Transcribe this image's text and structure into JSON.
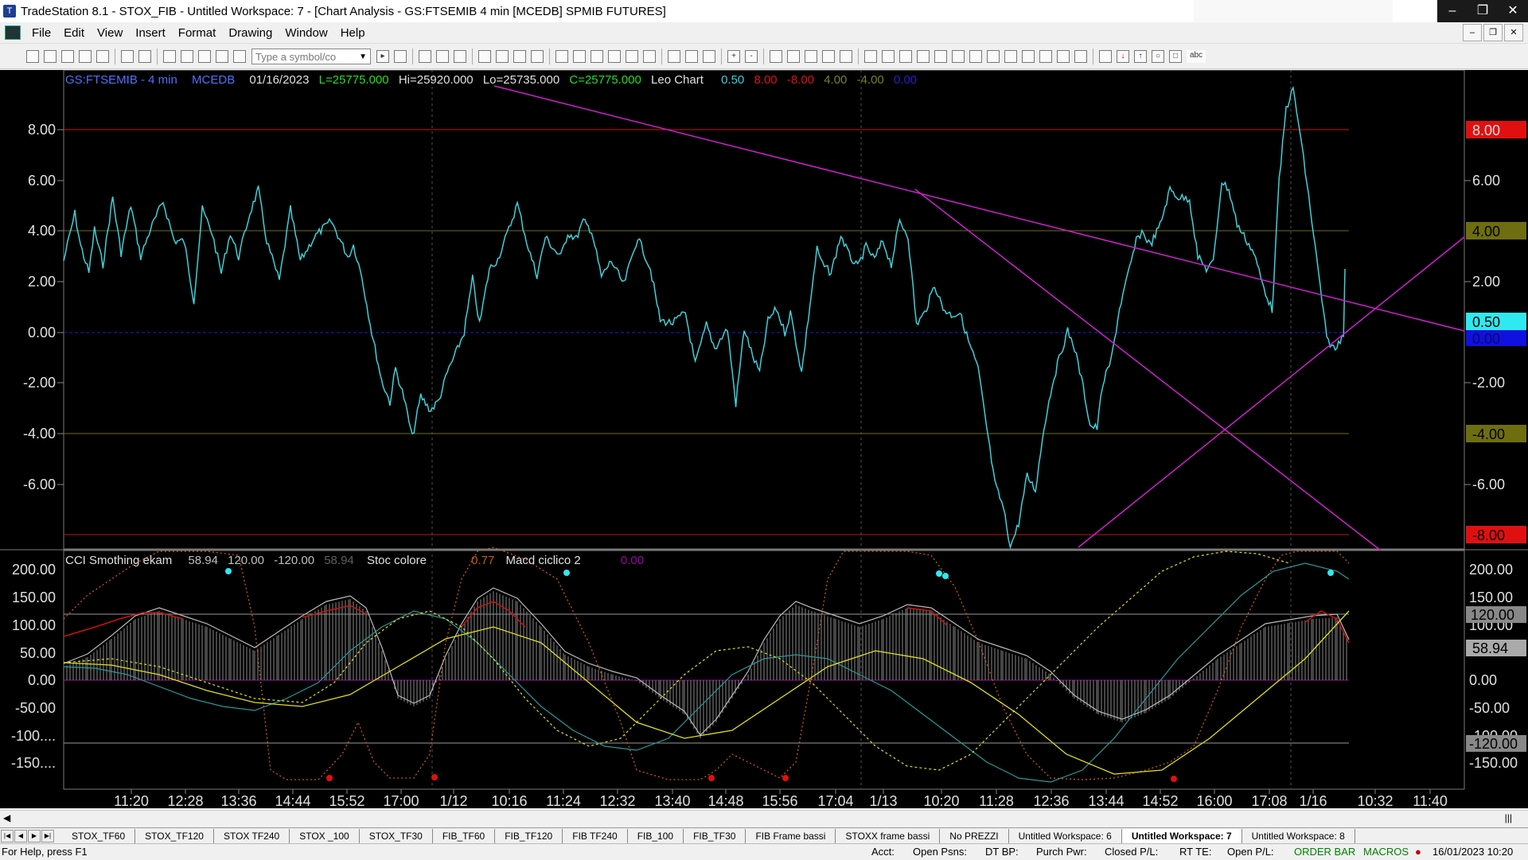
{
  "window": {
    "title": "TradeStation 8.1 - STOX_FIB - Untitled Workspace:  7 - [Chart Analysis - GS:FTSEMIB  4 min  [MCEDB] SPMIB FUTURES]"
  },
  "menu": [
    "File",
    "Edit",
    "View",
    "Insert",
    "Format",
    "Drawing",
    "Window",
    "Help"
  ],
  "toolbar": {
    "symbol_placeholder": "Type a symbol/co"
  },
  "chart_header": {
    "symbol": "GS:FTSEMIB - 4 min",
    "feed": "MCEDB",
    "date": "01/16/2023",
    "last": "L=25775.000",
    "high": "Hi=25920.000",
    "low": "Lo=25735.000",
    "close": "C=25775.000",
    "study": "Leo Chart",
    "v1": "0.50",
    "v2": "8.00",
    "v3": "-8.00",
    "v4": "4.00",
    "v5": "-4.00",
    "v6": "0.00"
  },
  "lower_header": {
    "study1": "CCI Smothing ekam",
    "a": "58.94",
    "b": "120.00",
    "c": "-120.00",
    "d": "58.94",
    "study2": "Stoc colore",
    "e": "0.77",
    "study3": "Macd ciclico 2",
    "f": "0.00"
  },
  "upper_axis": [
    "8.00",
    "6.00",
    "4.00",
    "2.00",
    "0.00",
    "-2.00",
    "-4.00",
    "-6.00"
  ],
  "upper_right_axis": [
    "8.00",
    "6.00",
    "4.00",
    "2.00",
    "0.50",
    "0.00",
    "-2.00",
    "-4.00",
    "-6.00",
    "-8.00"
  ],
  "lower_axis": [
    "200.00",
    "150.00",
    "100.00",
    "50.00",
    "0.00",
    "-50.00",
    "-100....",
    "-150...."
  ],
  "lower_right_axis": [
    "200.00",
    "150.00",
    "120.00",
    "100.00",
    "58.94",
    "0.00",
    "-50.00",
    "-100.00",
    "-120.00",
    "-150.00"
  ],
  "time_axis": [
    "11:20",
    "12:28",
    "13:36",
    "14:44",
    "15:52",
    "17:00",
    "1/12",
    "10:16",
    "11:24",
    "12:32",
    "13:40",
    "14:48",
    "15:56",
    "17:04",
    "1/13",
    "10:20",
    "11:28",
    "12:36",
    "13:44",
    "14:52",
    "16:00",
    "17:08",
    "1/16",
    "10:32",
    "11:40"
  ],
  "colors": {
    "price": "#3fd0d8",
    "trend": "#d020d0",
    "red_line": "#d01010",
    "olive_line": "#6e6e10",
    "zero_line": "#2020d0"
  },
  "workspace_tabs": [
    "STOX_TF60",
    "STOX_TF120",
    "STOX TF240",
    "STOX _100",
    "STOX_TF30",
    "FIB_TF60",
    "FIB_TF120",
    "FIB TF240",
    "FIB_100",
    "FIB_TF30",
    "FIB Frame bassi",
    "STOXX frame bassi",
    "No PREZZI",
    "Untitled Workspace:  6",
    "Untitled Workspace:  7",
    "Untitled Workspace:  8"
  ],
  "status": {
    "help": "For Help, press F1",
    "acct": "Acct:",
    "open_psns": "Open Psns:",
    "dt_bp": "DT BP:",
    "purch_pwr": "Purch Pwr:",
    "closed_pl": "Closed P/L:",
    "rt_te": "RT TE:",
    "open_pl": "Open P/L:",
    "order_bar": "ORDER BAR",
    "macros": "MACROS",
    "datetime": "16/01/2023 10:20"
  }
}
